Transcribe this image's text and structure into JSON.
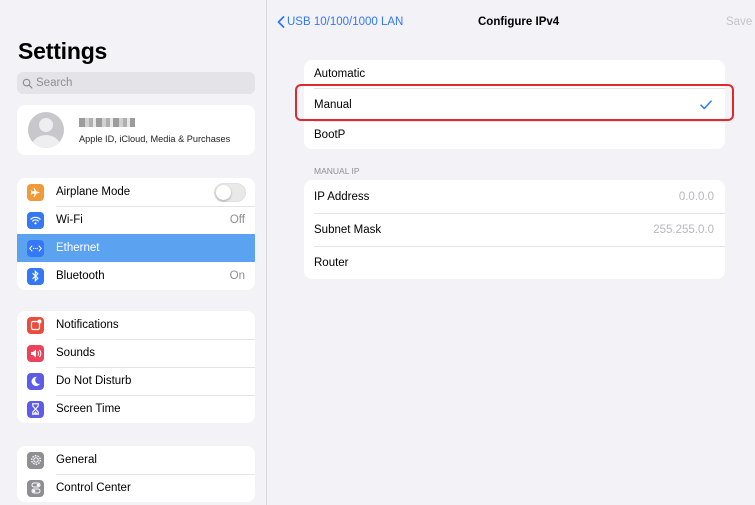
{
  "sidebar": {
    "title": "Settings",
    "search_placeholder": "Search",
    "profile": {
      "subtitle": "Apple ID, iCloud, Media & Purchases"
    },
    "network": [
      {
        "label": "Airplane Mode",
        "value": "",
        "icon": "airplane-icon",
        "color": "#f19a37"
      },
      {
        "label": "Wi-Fi",
        "value": "Off",
        "icon": "wifi-icon",
        "color": "#3478f6"
      },
      {
        "label": "Ethernet",
        "value": "",
        "icon": "ethernet-icon",
        "color": "#3478f6"
      },
      {
        "label": "Bluetooth",
        "value": "On",
        "icon": "bluetooth-icon",
        "color": "#3478f6"
      }
    ],
    "notifications": [
      {
        "label": "Notifications",
        "icon": "notifications-icon",
        "color": "#eb4d3d"
      },
      {
        "label": "Sounds",
        "icon": "sounds-icon",
        "color": "#eb445a"
      },
      {
        "label": "Do Not Disturb",
        "icon": "moon-icon",
        "color": "#5e5ce6"
      },
      {
        "label": "Screen Time",
        "icon": "hourglass-icon",
        "color": "#5e5ce6"
      }
    ],
    "general": [
      {
        "label": "General",
        "icon": "gear-icon",
        "color": "#8e8e93"
      },
      {
        "label": "Control Center",
        "icon": "switches-icon",
        "color": "#8e8e93"
      }
    ]
  },
  "detail": {
    "back_label": "USB 10/100/1000 LAN",
    "title": "Configure IPv4",
    "save_label": "Save",
    "options": [
      {
        "label": "Automatic"
      },
      {
        "label": "Manual",
        "selected": true
      },
      {
        "label": "BootP"
      }
    ],
    "manual_header": "MANUAL IP",
    "fields": [
      {
        "label": "IP Address",
        "value": "0.0.0.0"
      },
      {
        "label": "Subnet Mask",
        "value": "255.255.0.0"
      },
      {
        "label": "Router",
        "value": ""
      }
    ]
  },
  "colors": {
    "accent": "#3478f6",
    "selection": "#5ba2f0",
    "highlight_box": "#e0282e"
  }
}
